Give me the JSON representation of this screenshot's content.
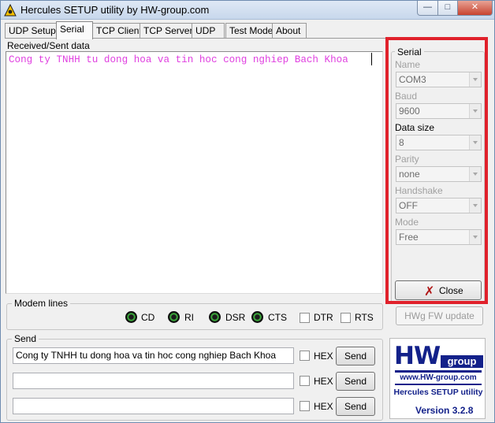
{
  "window": {
    "title": "Hercules SETUP utility by HW-group.com",
    "min_glyph": "—",
    "max_glyph": "□",
    "close_glyph": "✕"
  },
  "tabs": [
    {
      "label": "UDP Setup"
    },
    {
      "label": "Serial"
    },
    {
      "label": "TCP Client"
    },
    {
      "label": "TCP Server"
    },
    {
      "label": "UDP"
    },
    {
      "label": "Test Mode"
    },
    {
      "label": "About"
    }
  ],
  "received": {
    "label": "Received/Sent data",
    "text": "Cong ty TNHH tu dong hoa va tin hoc cong nghiep Bach Khoa"
  },
  "modem": {
    "title": "Modem lines",
    "leds": [
      "CD",
      "RI",
      "DSR",
      "CTS"
    ],
    "checks": [
      "DTR",
      "RTS"
    ]
  },
  "send": {
    "title": "Send",
    "rows": [
      {
        "value": "Cong ty TNHH tu dong hoa va tin hoc cong nghiep Bach Khoa",
        "hex_label": "HEX",
        "button": "Send"
      },
      {
        "value": "",
        "hex_label": "HEX",
        "button": "Send"
      },
      {
        "value": "",
        "hex_label": "HEX",
        "button": "Send"
      }
    ]
  },
  "serial": {
    "title": "Serial",
    "fields": [
      {
        "label": "Name",
        "value": "COM3"
      },
      {
        "label": "Baud",
        "value": "9600"
      },
      {
        "label": "Data size",
        "value": "8"
      },
      {
        "label": "Parity",
        "value": "none"
      },
      {
        "label": "Handshake",
        "value": "OFF"
      },
      {
        "label": "Mode",
        "value": "Free"
      }
    ],
    "close_label": "Close"
  },
  "hwg_button": "HWg FW update",
  "logo": {
    "brand": "HW",
    "group": "group",
    "url": "www.HW-group.com",
    "name": "Hercules SETUP utility",
    "version": "Version  3.2.8"
  },
  "colors": {
    "received_text": "#e040e0",
    "highlight_frame": "#e0212b",
    "logo_blue": "#13218a"
  }
}
